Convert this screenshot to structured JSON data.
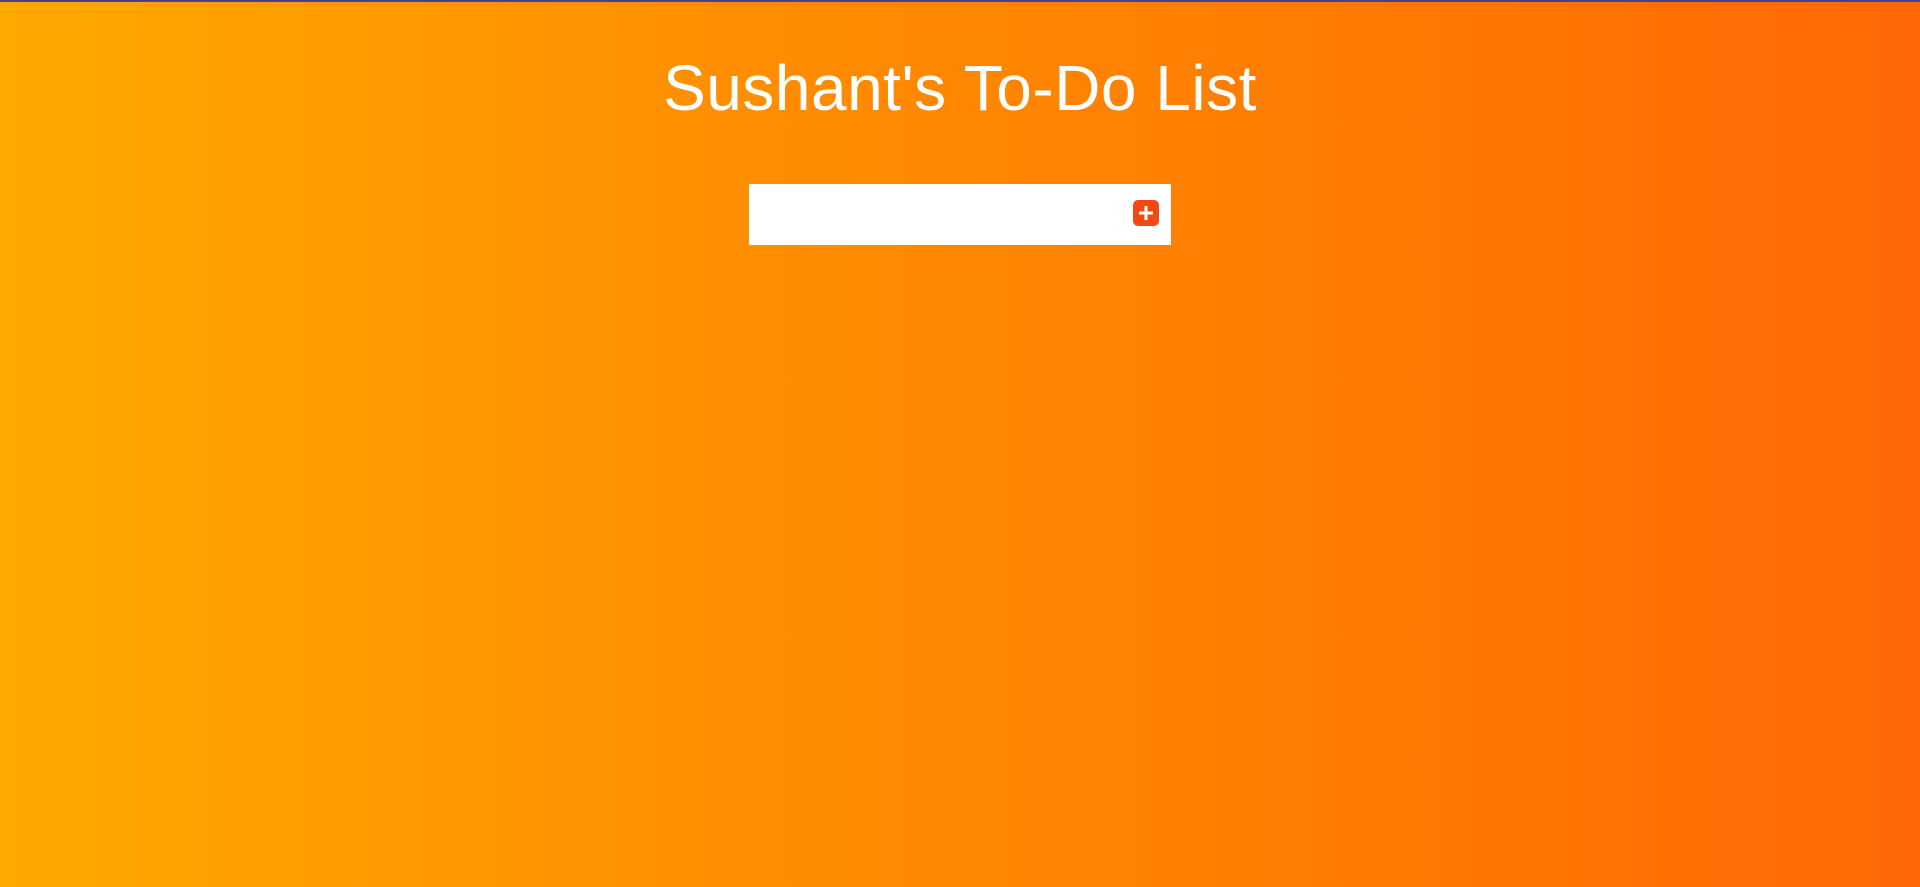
{
  "app": {
    "title": "Sushant's To-Do List"
  },
  "input": {
    "value": "",
    "placeholder": ""
  },
  "add_button": {
    "icon": "plus-icon"
  },
  "colors": {
    "gradient_start": "#ffa800",
    "gradient_end": "#ff6805",
    "accent": "#f04a12",
    "title_text": "#ffffff"
  }
}
